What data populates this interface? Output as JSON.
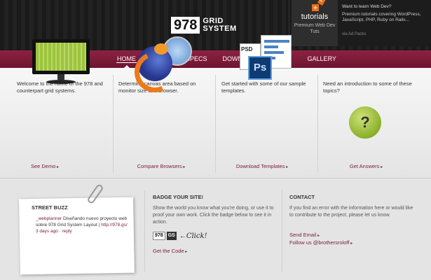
{
  "header": {
    "logo_number": "978",
    "logo_line1": "GRID",
    "logo_line2": "SYSTEM"
  },
  "ad": {
    "brand": "tutorials",
    "premium": "Premium Web Dev Tuts",
    "ribbon": "From $9",
    "title": "Want to learn Web Dev?",
    "body": "Premium tutorials covering WordPress, JavaScript, PHP, Ruby on Rails...",
    "via": "via Ad Packs"
  },
  "nav": {
    "items": [
      {
        "label": "HOME",
        "active": true
      },
      {
        "label": "BROWSER SPECS",
        "active": false
      },
      {
        "label": "DOWNLOADS",
        "active": false
      },
      {
        "label": "FAQ",
        "active": false
      },
      {
        "label": "GALLERY",
        "active": false
      }
    ]
  },
  "features": [
    {
      "text": "Welcome to the home of the 978 and counterpart grid systems.",
      "link": "See Demo"
    },
    {
      "text": "Determine canvas area based on monitor size and browser.",
      "link": "Compare Browsers"
    },
    {
      "text": "Get started with some of our sample templates.",
      "link": "Download Templates"
    },
    {
      "text": "Need an introduction to some of these topics?",
      "link": "Get Answers"
    }
  ],
  "psd_label": "PSD",
  "ps_label": "Ps",
  "q_mark": "?",
  "buzz": {
    "title": "STREET BUZZ",
    "user": "_webplanner",
    "text": " Diseñando nuevo proyecto web sobre 978 Grid System Layout | ",
    "url": "http://978.gs/",
    "time": "3 days ago",
    "reply": "reply"
  },
  "badge": {
    "title": "BADGE YOUR SITE!",
    "text": "Show the world you know what you're doing, or use it to proof your own work. Click the badge below to see it in action.",
    "badge_num": "978",
    "badge_gs": "GS",
    "click": "Click!",
    "link": "Get the Code"
  },
  "contact": {
    "title": "CONTACT",
    "text": "If you find an error with the information here or would like to contribute to the project, please let us know.",
    "email": "Send Email",
    "follow": "Follow us @brothersroloff"
  }
}
